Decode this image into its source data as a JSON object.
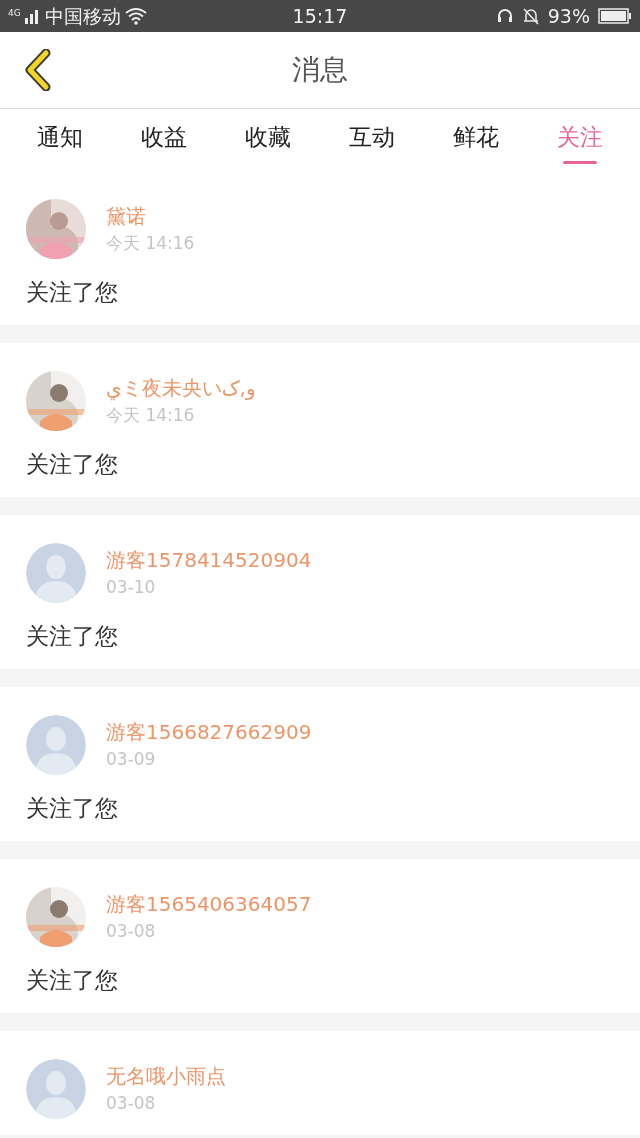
{
  "status_bar": {
    "network": "4G",
    "carrier": "中国移动",
    "time": "15:17",
    "battery": "93%"
  },
  "header": {
    "title": "消息"
  },
  "tabs": [
    {
      "label": "通知",
      "selected": false
    },
    {
      "label": "收益",
      "selected": false
    },
    {
      "label": "收藏",
      "selected": false
    },
    {
      "label": "互动",
      "selected": false
    },
    {
      "label": "鲜花",
      "selected": false
    },
    {
      "label": "关注",
      "selected": true
    }
  ],
  "messages": [
    {
      "name": "黛诺",
      "time": "今天 14:16",
      "text": "关注了您"
    },
    {
      "name": "يミ夜未央いو,ک",
      "time": "今天 14:16",
      "text": "关注了您"
    },
    {
      "avatar": {
        "kind": "default"
      },
      "name": "游客1578414520904",
      "time": "03-10",
      "text": "关注了您"
    },
    {
      "avatar": {
        "kind": "default"
      },
      "name": "游客1566827662909",
      "time": "03-09",
      "text": "关注了您"
    },
    {
      "name": "游客1565406364057",
      "time": "03-08",
      "text": "关注了您"
    },
    {
      "avatar": {
        "kind": "default"
      },
      "name": "无名哦小雨点",
      "time": "03-08"
    }
  ]
}
